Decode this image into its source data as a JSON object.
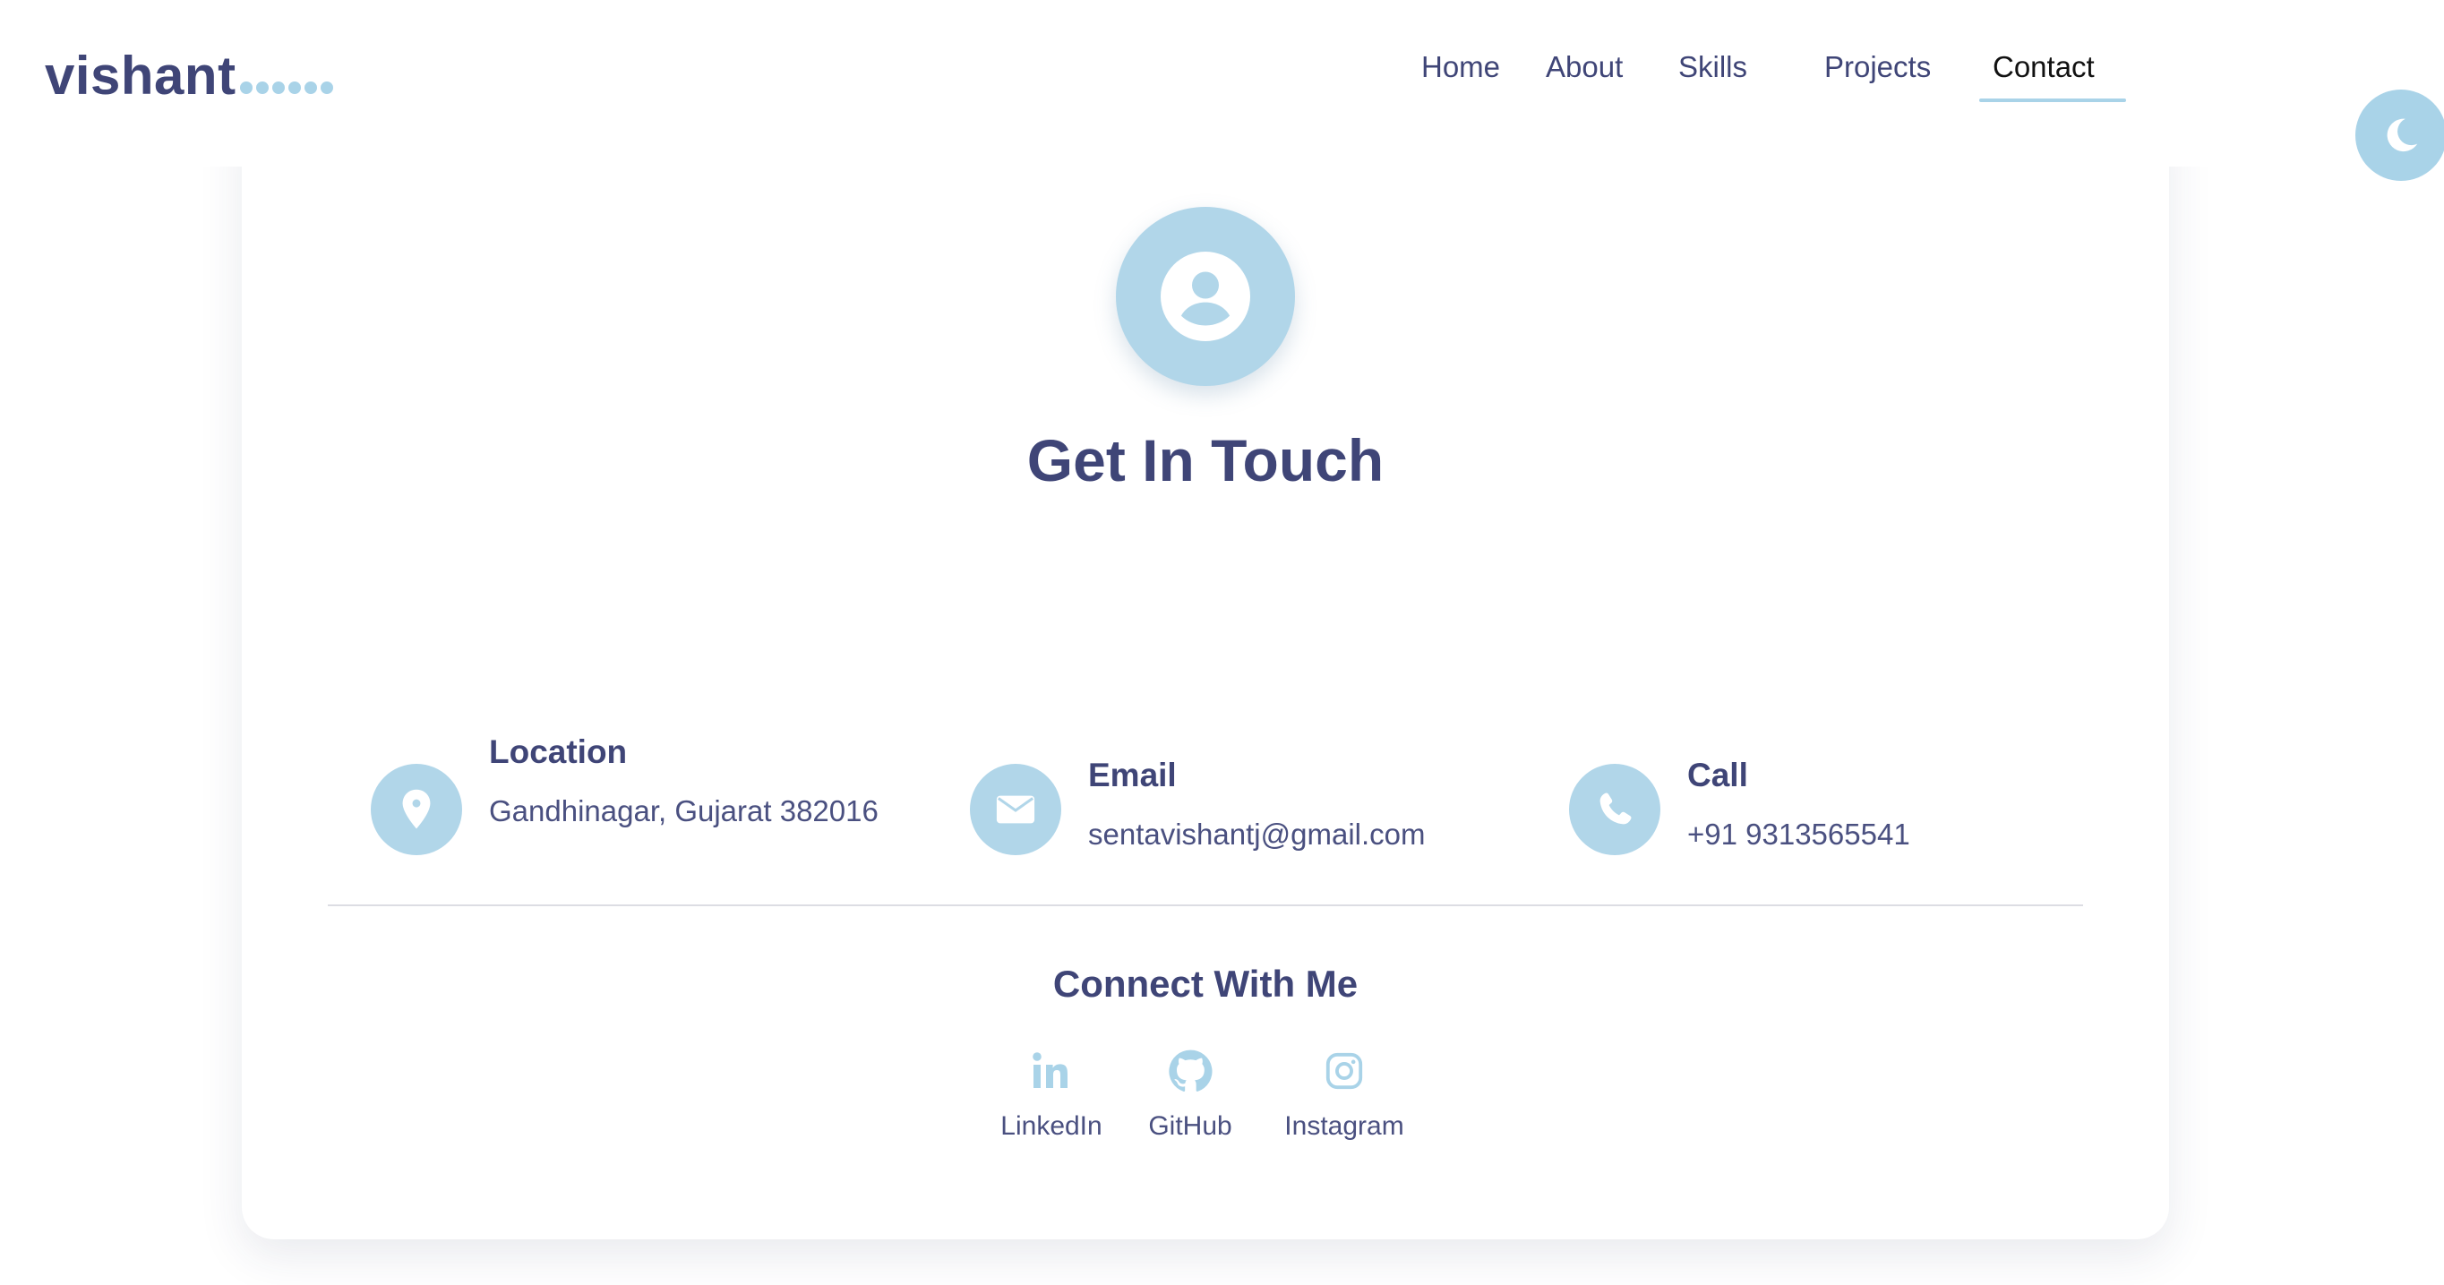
{
  "brand": {
    "name": "vishant",
    "dots": 6,
    "accent": "#a9d3e8",
    "text_color": "#3f4577"
  },
  "nav": {
    "items": [
      "Home",
      "About",
      "Skills",
      "Projects",
      "Contact"
    ],
    "active": "Contact"
  },
  "theme_toggle": {
    "icon": "moon-icon"
  },
  "contact": {
    "avatar_icon": "user-circle-icon",
    "title": "Get In Touch",
    "items": [
      {
        "icon": "location-pin-icon",
        "label": "Location",
        "value": "Gandhinagar, Gujarat 382016"
      },
      {
        "icon": "envelope-icon",
        "label": "Email",
        "value": "sentavishantj@gmail.com"
      },
      {
        "icon": "phone-icon",
        "label": "Call",
        "value": "+91 9313565541"
      }
    ],
    "connect_title": "Connect With Me",
    "socials": [
      {
        "icon": "linkedin-icon",
        "label": "LinkedIn"
      },
      {
        "icon": "github-icon",
        "label": "GitHub"
      },
      {
        "icon": "instagram-icon",
        "label": "Instagram"
      }
    ]
  }
}
